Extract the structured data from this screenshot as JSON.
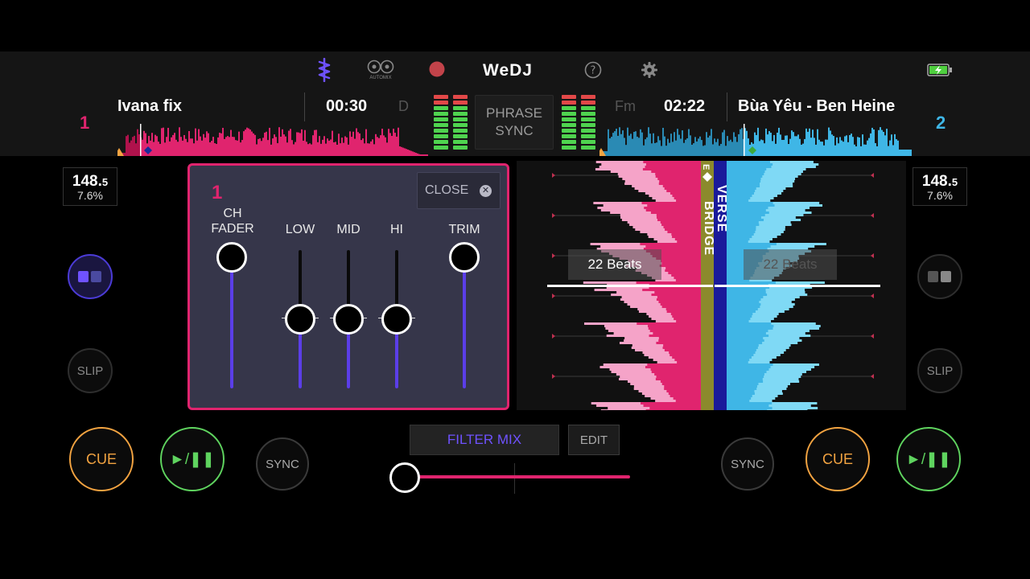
{
  "header": {
    "logo": "WeDJ",
    "automix_label": "AUTOMIX",
    "phrase_sync": "PHRASE SYNC"
  },
  "deck1": {
    "number": "1",
    "title": "Ivana fix",
    "time": "00:30",
    "key": "D",
    "bpm_main": "148.",
    "bpm_decimal": "5",
    "pitch": "7.6%",
    "slip": "SLIP",
    "cue": "CUE",
    "play": "►/❚❚",
    "sync": "SYNC"
  },
  "deck2": {
    "number": "2",
    "title": "Bùa Yêu - Ben Heine",
    "time": "02:22",
    "key": "Fm",
    "bpm_main": "148.",
    "bpm_decimal": "5",
    "pitch": "7.6%",
    "slip": "SLIP",
    "cue": "CUE",
    "play": "►/❚❚",
    "sync": "SYNC"
  },
  "mixer": {
    "deck": "1",
    "close": "CLOSE",
    "labels": {
      "ch_fader_1": "CH",
      "ch_fader_2": "FADER",
      "low": "LOW",
      "mid": "MID",
      "hi": "HI",
      "trim": "TRIM"
    },
    "levels": {
      "ch_fader": 1.0,
      "low": 0.5,
      "mid": 0.5,
      "hi": 0.5,
      "trim": 1.0
    }
  },
  "waveform": {
    "beats_left": "22 Beats",
    "beats_right": "22 Beats",
    "section_bridge": "BRIDGE",
    "section_verse": "VERSE",
    "section_top": "E"
  },
  "bottom": {
    "filter_mix": "FILTER MIX",
    "edit": "EDIT",
    "crossfader": 0.0
  },
  "colors": {
    "deck1": "#e0246e",
    "deck2": "#3fb6e6",
    "accent": "#5b3ee8",
    "cue": "#f2a341",
    "play": "#5fd45f"
  }
}
